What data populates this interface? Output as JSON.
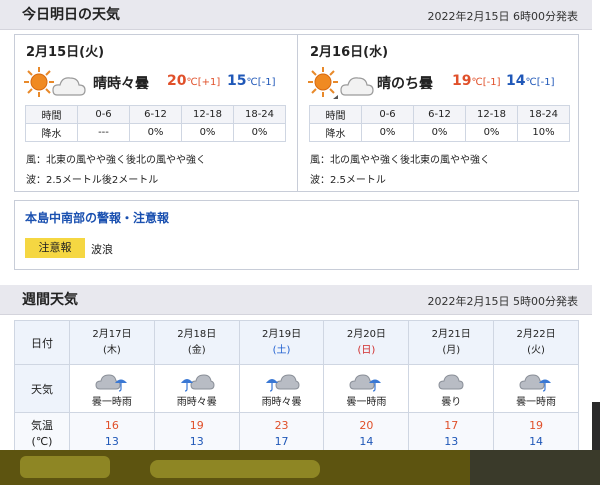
{
  "today": {
    "title": "今日明日の天気",
    "issued": "2022年2月15日 6時00分発表",
    "days": [
      {
        "date": "2月15日(火)",
        "telop": "晴時々曇",
        "high": "20",
        "high_diff": "℃[+1]",
        "low": "15",
        "low_diff": "℃[-1]",
        "icon": "sun-cloud-icon",
        "rain_headers": [
          "時間",
          "0-6",
          "6-12",
          "12-18",
          "18-24"
        ],
        "rain_values": [
          "降水",
          "---",
          "0%",
          "0%",
          "0%"
        ],
        "wind": "風：北東の風やや強く後北の風やや強く",
        "wave": "波：2.5メートル後2メートル"
      },
      {
        "date": "2月16日(水)",
        "telop": "晴のち曇",
        "high": "19",
        "high_diff": "℃[-1]",
        "low": "14",
        "low_diff": "℃[-1]",
        "icon": "sun-then-cloud-icon",
        "rain_headers": [
          "時間",
          "0-6",
          "6-12",
          "12-18",
          "18-24"
        ],
        "rain_values": [
          "降水",
          "0%",
          "0%",
          "0%",
          "10%"
        ],
        "wind": "風：北の風やや強く後北東の風やや強く",
        "wave": "波：2.5メートル"
      }
    ]
  },
  "warning": {
    "title": "本島中南部の警報・注意報",
    "badge": "注意報",
    "text": "波浪"
  },
  "weekly": {
    "title": "週間天気",
    "issued": "2022年2月15日 5時00分発表",
    "row_labels": {
      "date": "日付",
      "weather": "天気",
      "temp_line1": "気温",
      "temp_line2": "(℃)"
    },
    "days": [
      {
        "date": "2月17日",
        "dow": "(木)",
        "weather": "曇一時雨",
        "high": "16",
        "low": "13",
        "icon": "cloud-rain-icon"
      },
      {
        "date": "2月18日",
        "dow": "(金)",
        "weather": "雨時々曇",
        "high": "19",
        "low": "13",
        "icon": "rain-cloud-icon"
      },
      {
        "date": "2月19日",
        "dow": "(土)",
        "weather": "雨時々曇",
        "high": "23",
        "low": "17",
        "icon": "rain-cloud-icon"
      },
      {
        "date": "2月20日",
        "dow": "(日)",
        "weather": "曇一時雨",
        "high": "20",
        "low": "14",
        "icon": "cloud-rain-icon"
      },
      {
        "date": "2月21日",
        "dow": "(月)",
        "weather": "曇り",
        "high": "17",
        "low": "13",
        "icon": "cloud-icon"
      },
      {
        "date": "2月22日",
        "dow": "(火)",
        "weather": "曇一時雨",
        "high": "19",
        "low": "14",
        "icon": "cloud-rain-icon"
      }
    ]
  },
  "colors": {
    "high": "#e0502a",
    "low": "#2058b8",
    "header_bg": "#e8e8ee",
    "warning_badge": "#f5d742",
    "saturday": "#1f5fd0",
    "sunday": "#d02a2a"
  }
}
